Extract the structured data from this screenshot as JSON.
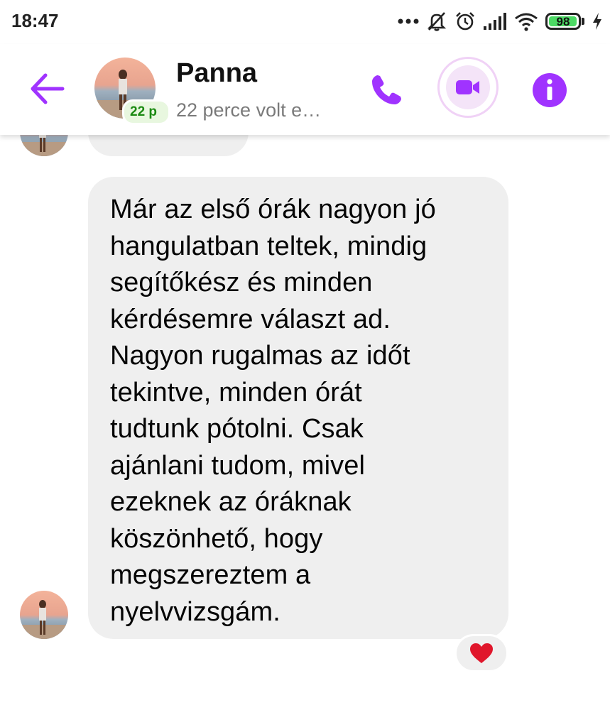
{
  "status_bar": {
    "time": "18:47",
    "icons": [
      "more-dots-icon",
      "bell-off-icon",
      "alarm-icon",
      "signal-icon",
      "wifi-icon",
      "battery-icon",
      "charging-icon"
    ],
    "battery_level": "98"
  },
  "header": {
    "contact_name": "Panna",
    "last_seen": "22 perce volt e…",
    "presence_badge": "22 p",
    "accent_color": "#a033ff"
  },
  "chat": {
    "message_text": "Már az első órák nagyon jó hangulatban teltek, mindig segítőkész és minden kérdésemre választ ad. Nagyon rugalmas az időt tekintve, minden órát tudtunk pótolni. Csak ajánlani tudom, mivel ezeknek az óráknak köszönhető, hogy megszereztem a nyelvvizsgám.",
    "message_lines": [
      "Már az első órák nagyon jó",
      "hangulatban teltek, mindig",
      "segítőkész és minden",
      "kérdésemre választ ad.",
      "Nagyon rugalmas az időt",
      "tekintve, minden órát",
      "tudtunk pótolni. Csak",
      "ajánlani tudom, mivel",
      "ezeknek az óráknak",
      "köszönhető, hogy",
      "megszereztem a",
      "nyelvvizsgám."
    ],
    "reaction": "heart",
    "bubble_color": "#efefef"
  }
}
